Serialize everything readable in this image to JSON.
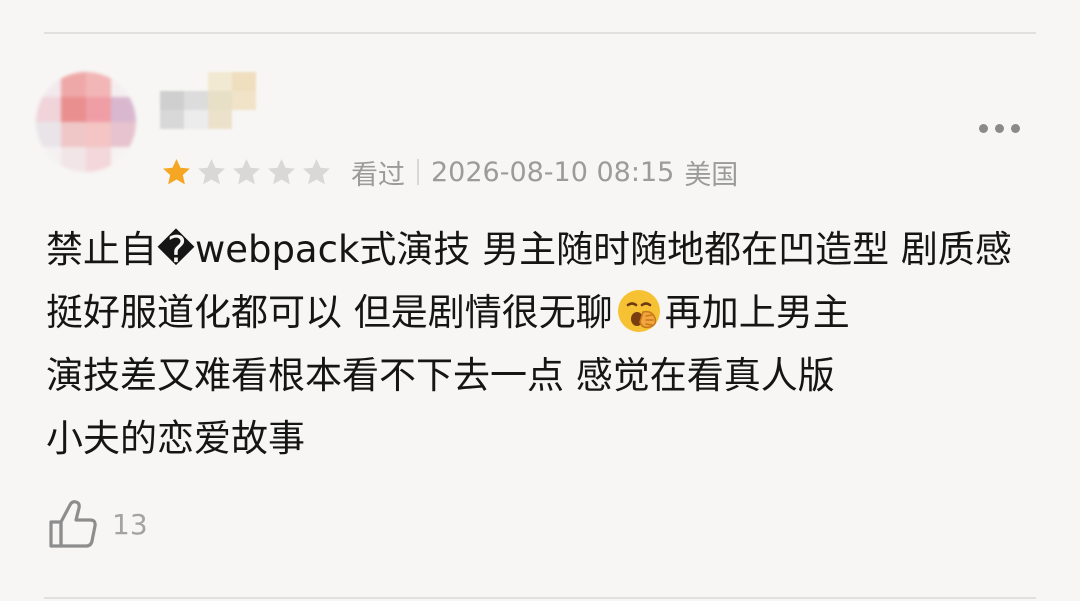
{
  "review": {
    "rating": 1,
    "rating_max": 5,
    "colors": {
      "star_filled": "#f5a623",
      "star_empty": "#d9d8d6"
    },
    "status": "看过",
    "datetime": "2026-08-10 08:15",
    "location": "美国",
    "text_lines": [
      "禁止自�webpack式演技 男主随时随地都在凹造型 剧质感",
      "挺好服道化都可以 但是剧情很无聊",
      "再加上男主",
      "演技差又难看根本看不下去一点 感觉在看真人版",
      "小夫的恋爱故事"
    ],
    "emoji": "yawning-face-icon",
    "likes": "13"
  },
  "icons": {
    "more": "more-dots-icon",
    "like": "thumbs-up-icon"
  }
}
